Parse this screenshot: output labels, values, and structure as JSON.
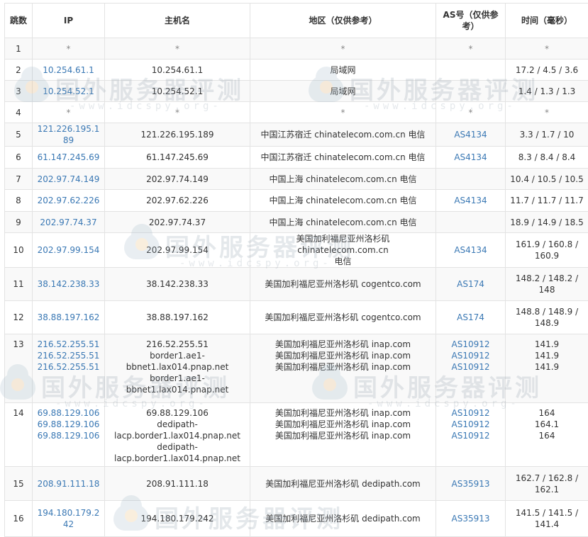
{
  "headers": {
    "hop": "跳数",
    "ip": "IP",
    "host": "主机名",
    "region": "地区（仅供参考）",
    "asn": "AS号（仅供参考）",
    "time": "时间（毫秒）"
  },
  "watermark": {
    "text": "国外服务器评测",
    "sub": "-www.idcspy.org-"
  },
  "rows": [
    {
      "hop": "1",
      "ip": [
        "*"
      ],
      "host": [
        "*"
      ],
      "region": [
        "*"
      ],
      "asn": [
        "*"
      ],
      "time": [
        "*"
      ]
    },
    {
      "hop": "2",
      "ip": [
        "10.254.61.1"
      ],
      "host": [
        "10.254.61.1"
      ],
      "region": [
        "局域网"
      ],
      "asn": [],
      "time": [
        "17.2 / 4.5 / 3.6"
      ]
    },
    {
      "hop": "3",
      "ip": [
        "10.254.52.1"
      ],
      "host": [
        "10.254.52.1"
      ],
      "region": [
        "局域网"
      ],
      "asn": [],
      "time": [
        "1.4 / 1.3 / 1.3"
      ]
    },
    {
      "hop": "4",
      "ip": [
        "*"
      ],
      "host": [
        "*"
      ],
      "region": [
        "*"
      ],
      "asn": [
        "*"
      ],
      "time": [
        "*"
      ]
    },
    {
      "hop": "5",
      "ip": [
        "121.226.195.189"
      ],
      "host": [
        "121.226.195.189"
      ],
      "region": [
        "中国江苏宿迁 chinatelecom.com.cn 电信"
      ],
      "asn": [
        "AS4134"
      ],
      "time": [
        "3.3 / 1.7 / 10"
      ]
    },
    {
      "hop": "6",
      "ip": [
        "61.147.245.69"
      ],
      "host": [
        "61.147.245.69"
      ],
      "region": [
        "中国江苏宿迁 chinatelecom.com.cn 电信"
      ],
      "asn": [
        "AS4134"
      ],
      "time": [
        "8.3 / 8.4 / 8.4"
      ]
    },
    {
      "hop": "7",
      "ip": [
        "202.97.74.149"
      ],
      "host": [
        "202.97.74.149"
      ],
      "region": [
        "中国上海 chinatelecom.com.cn 电信"
      ],
      "asn": [],
      "time": [
        "10.4 / 10.5 / 10.5"
      ]
    },
    {
      "hop": "8",
      "ip": [
        "202.97.62.226"
      ],
      "host": [
        "202.97.62.226"
      ],
      "region": [
        "中国上海 chinatelecom.com.cn 电信"
      ],
      "asn": [
        "AS4134"
      ],
      "time": [
        "11.7 / 11.7 / 11.7"
      ]
    },
    {
      "hop": "9",
      "ip": [
        "202.97.74.37"
      ],
      "host": [
        "202.97.74.37"
      ],
      "region": [
        "中国上海 chinatelecom.com.cn 电信"
      ],
      "asn": [],
      "time": [
        "18.9 / 14.9 / 18.5"
      ]
    },
    {
      "hop": "10",
      "ip": [
        "202.97.99.154"
      ],
      "host": [
        "202.97.99.154"
      ],
      "region": [
        "美国加利福尼亚州洛杉矶 chinatelecom.com.cn",
        "电信"
      ],
      "asn": [
        "AS4134"
      ],
      "time": [
        "161.9 / 160.8 /",
        "160.9"
      ]
    },
    {
      "hop": "11",
      "ip": [
        "38.142.238.33"
      ],
      "host": [
        "38.142.238.33"
      ],
      "region": [
        "美国加利福尼亚州洛杉矶 cogentco.com"
      ],
      "asn": [
        "AS174"
      ],
      "time": [
        "148.2 / 148.2 /",
        "148"
      ]
    },
    {
      "hop": "12",
      "ip": [
        "38.88.197.162"
      ],
      "host": [
        "38.88.197.162"
      ],
      "region": [
        "美国加利福尼亚州洛杉矶 cogentco.com"
      ],
      "asn": [
        "AS174"
      ],
      "time": [
        "148.8 / 148.9 /",
        "148.9"
      ]
    },
    {
      "hop": "13",
      "ip": [
        "216.52.255.51",
        "216.52.255.51",
        "216.52.255.51"
      ],
      "host": [
        "216.52.255.51",
        "border1.ae1-",
        "bbnet1.lax014.pnap.net",
        "border1.ae1-",
        "bbnet1.lax014.pnap.net"
      ],
      "region": [
        "美国加利福尼亚州洛杉矶 inap.com",
        "美国加利福尼亚州洛杉矶 inap.com",
        "美国加利福尼亚州洛杉矶 inap.com"
      ],
      "asn": [
        "AS10912",
        "AS10912",
        "AS10912"
      ],
      "time": [
        "141.9",
        "141.9",
        "141.9"
      ]
    },
    {
      "hop": "14",
      "ip": [
        "69.88.129.106",
        "69.88.129.106",
        "69.88.129.106"
      ],
      "host": [
        "69.88.129.106",
        "dedipath-",
        "lacp.border1.lax014.pnap.net",
        "dedipath-",
        "lacp.border1.lax014.pnap.net"
      ],
      "region": [
        "美国加利福尼亚州洛杉矶 inap.com",
        "美国加利福尼亚州洛杉矶 inap.com",
        "美国加利福尼亚州洛杉矶 inap.com"
      ],
      "asn": [
        "AS10912",
        "AS10912",
        "AS10912"
      ],
      "time": [
        "164",
        "164.1",
        "164"
      ]
    },
    {
      "hop": "15",
      "ip": [
        "208.91.111.18"
      ],
      "host": [
        "208.91.111.18"
      ],
      "region": [
        "美国加利福尼亚州洛杉矶 dedipath.com"
      ],
      "asn": [
        "AS35913"
      ],
      "time": [
        "162.7 / 162.8 /",
        "162.1"
      ]
    },
    {
      "hop": "16",
      "ip": [
        "194.180.179.242"
      ],
      "host": [
        "194.180.179.242"
      ],
      "region": [
        "美国加利福尼亚州洛杉矶 dedipath.com"
      ],
      "asn": [
        "AS35913"
      ],
      "time": [
        "141.5 / 141.5 /",
        "141.4"
      ]
    }
  ]
}
